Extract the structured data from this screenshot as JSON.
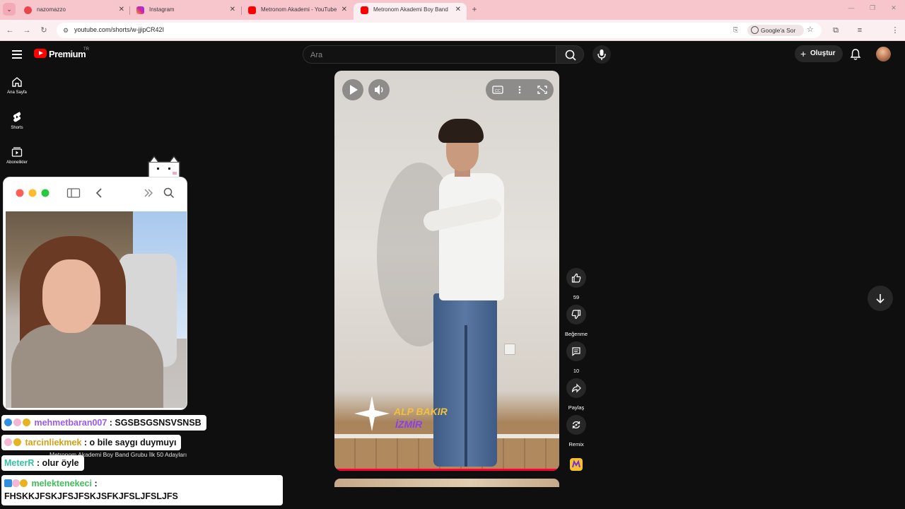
{
  "browser": {
    "tabs": [
      {
        "label": "nazomazzo",
        "favicon": "twitch-like-icon",
        "color": "#e8464c"
      },
      {
        "label": "Instagram",
        "favicon": "instagram-icon",
        "color": "#d6249f"
      },
      {
        "label": "Metronom Akademi - YouTube",
        "favicon": "youtube-icon",
        "color": "#ff0000"
      },
      {
        "label": "Metronom Akademi Boy Band",
        "favicon": "youtube-icon",
        "color": "#ff0000"
      }
    ],
    "url": "youtube.com/shorts/w-jjipCR42I",
    "google_sor": "Google'a Sor"
  },
  "youtube": {
    "brand": "Premium",
    "region": "TR",
    "search_placeholder": "Ara",
    "create_label": "Oluştur",
    "sidebar": [
      {
        "label": "Ana Sayfa",
        "icon": "home-icon"
      },
      {
        "label": "Shorts",
        "icon": "shorts-icon"
      },
      {
        "label": "Abonelikler",
        "icon": "subscriptions-icon"
      }
    ],
    "short": {
      "overlay_name": "ALP BAKIR",
      "overlay_city": "İZMİR",
      "likes": "59",
      "dislike_label": "Beğenme",
      "comments": "10",
      "share_label": "Paylaş",
      "remix_label": "Remix"
    }
  },
  "chat": {
    "messages": [
      {
        "user": "mehmetbaran007",
        "text": ": SGSBSGSNSVSNSB",
        "user_color": "#9b59f0"
      },
      {
        "user": "tarcinliekmek",
        "text": ": o bile saygı duymuyı",
        "user_color": "#d4a017"
      },
      {
        "user": "MeterR",
        "text": ": olur öyle",
        "user_color": "#35c2a0"
      },
      {
        "user": "melektenekeci",
        "text": ":",
        "user_color": "#3fbf5a"
      }
    ],
    "last_line": "FHSKKJFSKJFSJFSKJSFKJFSLJFSLJFS",
    "overlap_text": "Metronom Akademi Boy Band Grubu İlk 50 Adayları"
  },
  "colors": {
    "accent": "#ff0033",
    "tab_bg": "#f7c5cc"
  }
}
